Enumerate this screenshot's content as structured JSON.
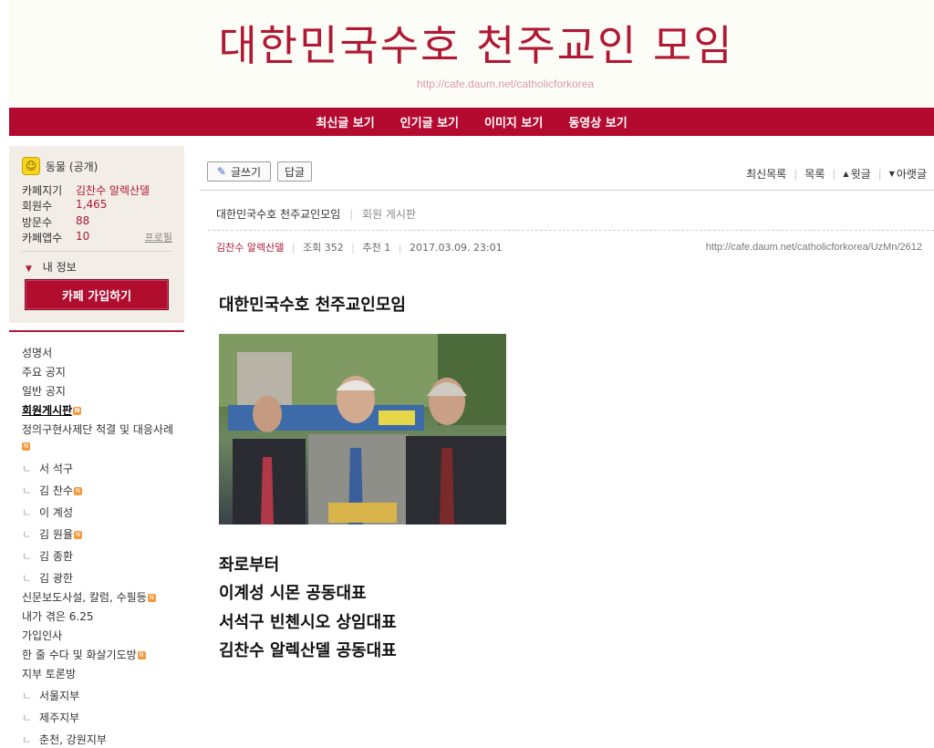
{
  "banner": {
    "title": "대한민국수호 천주교인 모임",
    "url": "http://cafe.daum.net/catholicforkorea"
  },
  "topnav": [
    "최신글 보기",
    "인기글 보기",
    "이미지 보기",
    "동영상 보기"
  ],
  "sidebar": {
    "status": "동물 (공개)",
    "rows": [
      {
        "label": "카페지기",
        "value": "김찬수 알렉산델"
      },
      {
        "label": "회원수",
        "value": "1,465"
      },
      {
        "label": "방문수",
        "value": "88"
      },
      {
        "label": "카페앱수",
        "value": "10"
      }
    ],
    "profile_link": "프로필",
    "my_info": "내 정보",
    "join_button": "카페 가입하기"
  },
  "menu": {
    "items": [
      {
        "label": "성명서",
        "sub": false,
        "new": false,
        "active": false
      },
      {
        "label": "주요 공지",
        "sub": false,
        "new": false,
        "active": false
      },
      {
        "label": "일반 공지",
        "sub": false,
        "new": false,
        "active": false
      },
      {
        "label": "회원게시판",
        "sub": false,
        "new": true,
        "active": true
      },
      {
        "label": "정의구현사제단 척결 및 대응사례",
        "sub": false,
        "new": true,
        "active": false
      },
      {
        "label": "서 석구",
        "sub": true,
        "new": false,
        "active": false
      },
      {
        "label": "김 찬수",
        "sub": true,
        "new": true,
        "active": false
      },
      {
        "label": "이 계성",
        "sub": true,
        "new": false,
        "active": false
      },
      {
        "label": "김 원율",
        "sub": true,
        "new": true,
        "active": false
      },
      {
        "label": "김 종환",
        "sub": true,
        "new": false,
        "active": false
      },
      {
        "label": "김 광한",
        "sub": true,
        "new": false,
        "active": false
      },
      {
        "label": "신문보도사설, 칼럼, 수필등",
        "sub": false,
        "new": true,
        "active": false
      },
      {
        "label": "내가 겪은 6.25",
        "sub": false,
        "new": false,
        "active": false
      },
      {
        "label": "가입인사",
        "sub": false,
        "new": false,
        "active": false
      },
      {
        "label": "한 줄 수다 및 화살기도방",
        "sub": false,
        "new": true,
        "active": false
      },
      {
        "label": "지부 토론방",
        "sub": false,
        "new": false,
        "active": false
      },
      {
        "label": "서울지부",
        "sub": true,
        "new": false,
        "active": false
      },
      {
        "label": "제주지부",
        "sub": true,
        "new": false,
        "active": false
      },
      {
        "label": "춘천, 강원지부",
        "sub": true,
        "new": false,
        "active": false
      }
    ],
    "new_badge": "N",
    "sub_mark": "ㄴ"
  },
  "toolbar": {
    "write": "글쓰기",
    "reply": "답글",
    "recent_list": "최신목록",
    "list": "목록",
    "prev": "윗글",
    "next": "아랫글"
  },
  "post": {
    "breadcrumb_cafe": "대한민국수호 천주교인모임",
    "breadcrumb_board": "회원 게시판",
    "author": "김찬수 알렉산델",
    "views": "조회 352",
    "recommend": "추천 1",
    "date": "2017.03.09. 23:01",
    "url": "http://cafe.daum.net/catholicforkorea/UzMn/2612",
    "title": "대한민국수호 천주교인모임",
    "captions": [
      "좌로부터",
      "이계성 시몬 공동대표",
      "서석구 빈첸시오 상임대표",
      "김찬수 알렉산델 공동대표"
    ]
  },
  "colors": {
    "brand": "#b40a2f",
    "banner_text": "#b01934",
    "side_bg": "#f2ede7",
    "new_badge": "#f39a3e"
  }
}
